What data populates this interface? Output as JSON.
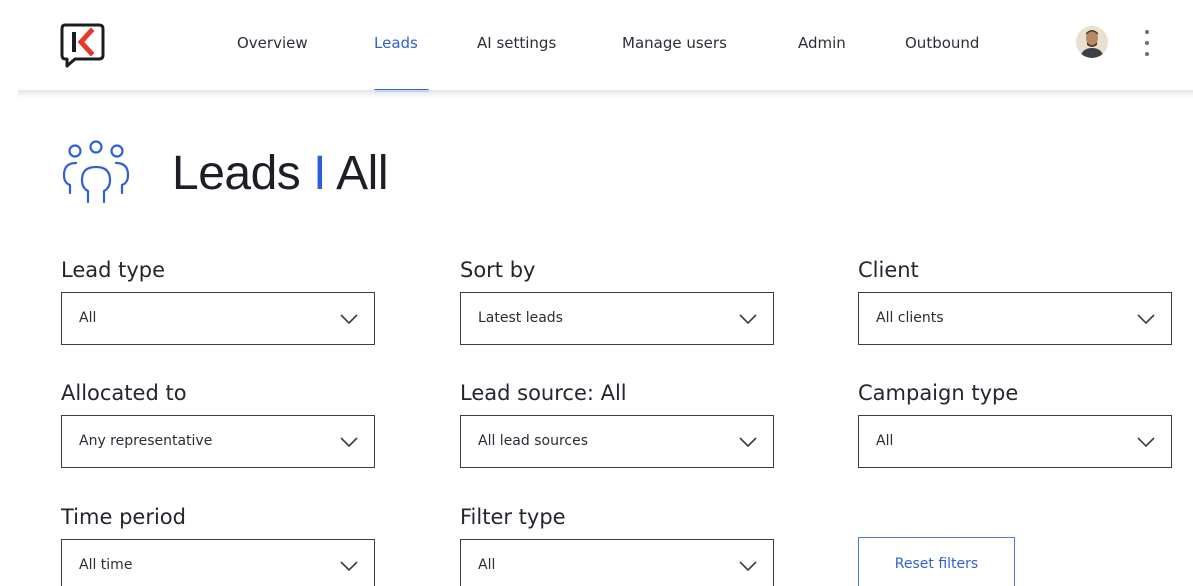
{
  "nav": {
    "items": [
      {
        "label": "Overview",
        "active": false
      },
      {
        "label": "Leads",
        "active": true
      },
      {
        "label": "AI settings",
        "active": false
      },
      {
        "label": "Manage users",
        "active": false
      },
      {
        "label": "Admin",
        "active": false
      },
      {
        "label": "Outbound",
        "active": false
      }
    ]
  },
  "page": {
    "title_main": "Leads",
    "title_sep": "I",
    "title_sub": "All"
  },
  "filters": {
    "lead_type": {
      "label": "Lead type",
      "value": "All"
    },
    "sort_by": {
      "label": "Sort by",
      "value": "Latest leads"
    },
    "client": {
      "label": "Client",
      "value": "All clients"
    },
    "allocated_to": {
      "label": "Allocated to",
      "value": "Any representative"
    },
    "lead_source": {
      "label": "Lead source: All",
      "value": "All lead sources"
    },
    "campaign_type": {
      "label": "Campaign type",
      "value": "All"
    },
    "time_period": {
      "label": "Time period",
      "value": "All time"
    },
    "filter_type": {
      "label": "Filter type",
      "value": "All"
    }
  },
  "actions": {
    "reset_label": "Reset filters"
  },
  "icons": {
    "logo": "k-logo-icon",
    "title": "users-group-icon",
    "dropdown": "chevron-down-icon",
    "menu": "kebab-menu-icon"
  },
  "colors": {
    "accent": "#2f5fd8",
    "logo_red": "#e6392b",
    "text": "#1c1f26"
  }
}
